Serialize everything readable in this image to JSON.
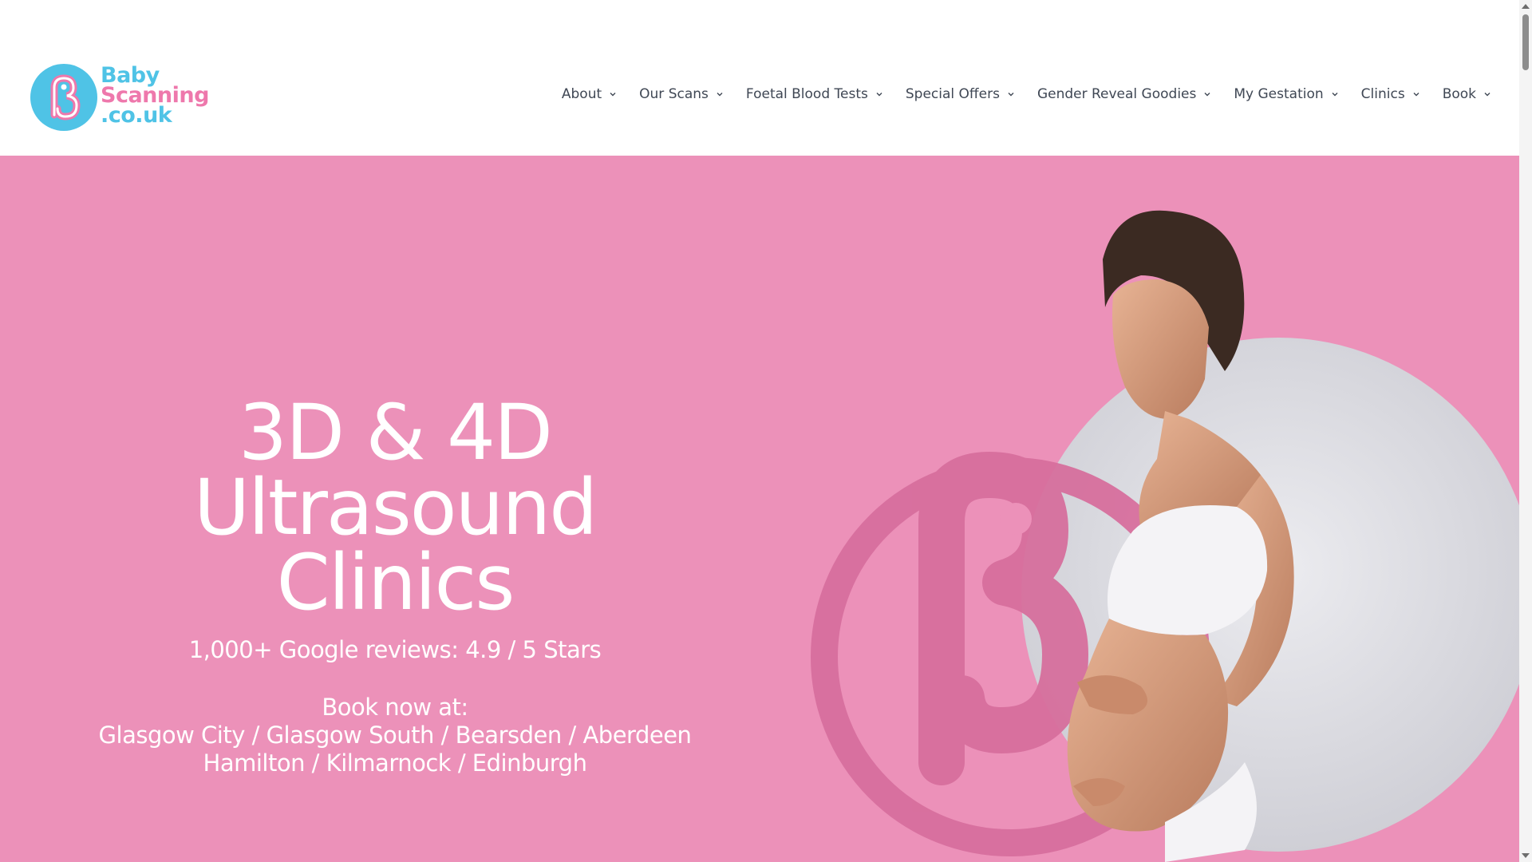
{
  "header": {
    "logo": {
      "line1": "Baby",
      "line2": "Scanning",
      "line3": ".co.uk",
      "icon": "baby-b-logo-icon"
    },
    "nav": [
      {
        "label": "About"
      },
      {
        "label": "Our Scans"
      },
      {
        "label": "Foetal Blood Tests"
      },
      {
        "label": "Special Offers"
      },
      {
        "label": "Gender Reveal Goodies"
      },
      {
        "label": "My Gestation"
      },
      {
        "label": "Clinics"
      },
      {
        "label": "Book"
      }
    ]
  },
  "hero": {
    "title_line1": "3D & 4D",
    "title_line2": "Ultrasound",
    "title_line3": "Clinics",
    "reviews": "1,000+ Google reviews: 4.9 / 5 Stars",
    "book_heading": "Book now at:",
    "book_line1": "Glasgow City / Glasgow South / Bearsden / Aberdeen",
    "book_line2": "Hamilton / Kilmarnock / Edinburgh"
  },
  "colors": {
    "hero_bg": "#ec91b9",
    "brand_blue": "#4fc3e6",
    "brand_pink": "#ee78ac",
    "nav_text": "#3f4754"
  }
}
